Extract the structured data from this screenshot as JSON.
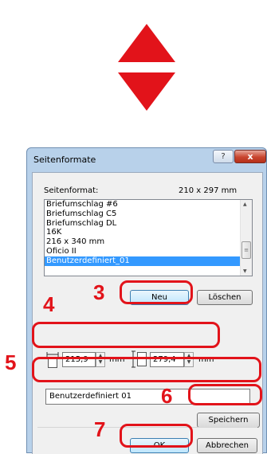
{
  "dialog": {
    "title": "Seitenformate",
    "help_label": "?",
    "close_label": "x",
    "format_label": "Seitenformat:",
    "format_size": "210 x 297 mm",
    "paper_list": [
      "Briefumschlag #6",
      "Briefumschlag C5",
      "Briefumschlag DL",
      "16K",
      "216 x 340 mm",
      "Oficio II",
      "Benutzerdefiniert_01"
    ],
    "selected_index": 6,
    "new_button": "Neu",
    "delete_button": "Löschen",
    "width_value": "215,9",
    "height_value": "279,4",
    "unit": "mm",
    "name_value": "Benutzerdefiniert 01",
    "save_button": "Speichern",
    "ok_button": "OK",
    "cancel_button": "Abbrechen"
  },
  "callouts": {
    "step3": "3",
    "step4": "4",
    "step5": "5",
    "step6": "6",
    "step7": "7"
  },
  "colors": {
    "highlight": "#e2131a",
    "selection": "#3399ff"
  }
}
